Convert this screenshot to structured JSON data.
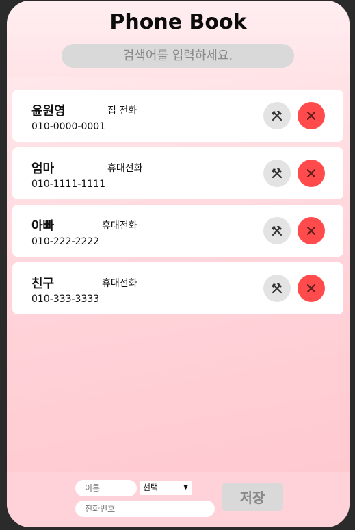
{
  "app": {
    "title": "Phone Book"
  },
  "search": {
    "placeholder": "검색어를 입력하세요."
  },
  "contacts": [
    {
      "name": "윤원영",
      "type": "집 전화",
      "number": "010-0000-0001"
    },
    {
      "name": "엄마",
      "type": "휴대전화",
      "number": "010-1111-1111"
    },
    {
      "name": "아빠",
      "type": "휴대전화",
      "number": "010-222-2222"
    },
    {
      "name": "친구",
      "type": "휴대전화",
      "number": "010-333-3333"
    }
  ],
  "icons": {
    "edit": "hammer-pick-icon",
    "delete": "close-icon"
  },
  "colors": {
    "delete_button": "#ff4b4b",
    "edit_button": "#e3e3e3"
  },
  "form": {
    "name_placeholder": "이름",
    "phone_placeholder": "전화번호",
    "type_selected": "선택",
    "save_label": "저장"
  }
}
